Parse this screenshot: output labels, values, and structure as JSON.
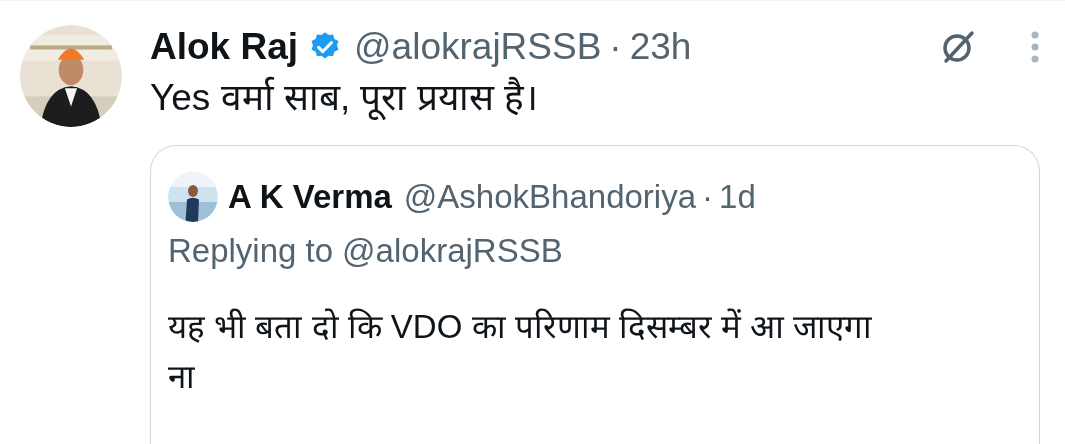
{
  "tweet": {
    "name": "Alok Raj",
    "verified": true,
    "handle": "@alokrajRSSB",
    "separator": "·",
    "time": "23h",
    "text": "Yes वर्मा साब, पूरा प्रयास है।",
    "quoted": {
      "name": "A K Verma",
      "handle": "@AshokBhandoriya",
      "separator": "·",
      "time": "1d",
      "replying_label": "Replying to",
      "replying_handle": "@alokrajRSSB",
      "text": "यह भी बता दो कि VDO का परिणाम दिसम्बर में आ जाएगा ना"
    }
  }
}
